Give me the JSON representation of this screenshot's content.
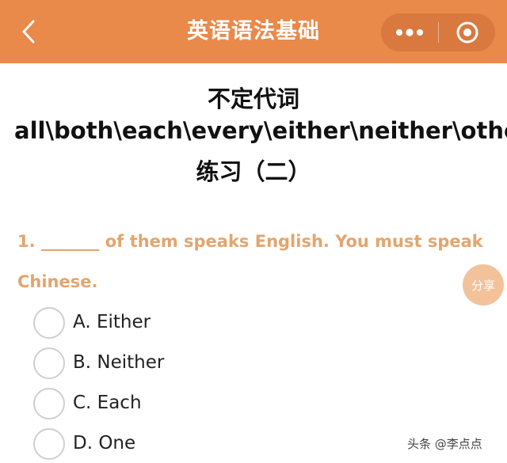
{
  "navbar": {
    "title": "英语语法基础",
    "back_icon": "chevron-left-icon",
    "more_icon": "more-dots-icon",
    "close_icon": "target-close-icon",
    "bar_color": "#e9894a"
  },
  "article": {
    "title_line1": "不定代词",
    "title_line2": "all\\both\\each\\every\\either\\neither\\other\\a",
    "title_line3": "练习（二）"
  },
  "question": {
    "text": "1. _______ of them speaks English. You must speak Chinese.",
    "color": "#e3a56d",
    "options": [
      {
        "label": "A. Either"
      },
      {
        "label": "B. Neither"
      },
      {
        "label": "C. Each"
      },
      {
        "label": "D. One"
      }
    ]
  },
  "share_button": {
    "label": "分享"
  },
  "watermark": {
    "text": "头条 @李点点"
  }
}
